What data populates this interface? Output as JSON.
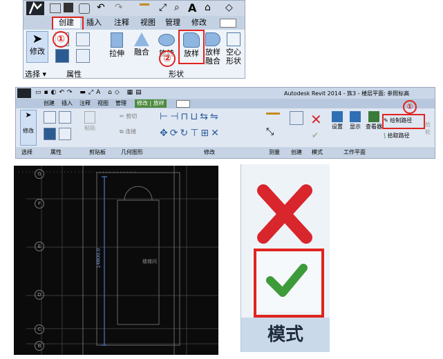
{
  "ribbon_top": {
    "tabs": [
      "创建",
      "插入",
      "注释",
      "视图",
      "管理",
      "修改"
    ],
    "buttons": {
      "modify": "修改",
      "extrude": "拉伸",
      "blend": "融合",
      "revolve": "旋转",
      "sweep": "放样",
      "swept_blend": "放样\n融合",
      "void": "空心\n形状"
    },
    "groups": {
      "select": "选择",
      "properties": "属性",
      "forms": "形状"
    },
    "markers": [
      "①",
      "②"
    ]
  },
  "ribbon_second": {
    "app_title": "Autodesk Revit 2014 -   族3 - 楼层平面: 参照标高",
    "tabs": [
      "创建",
      "插入",
      "注释",
      "视图",
      "管理",
      "修改 | 放样"
    ],
    "buttons": {
      "modify": "修改",
      "paste": "粘贴",
      "cut": "剪切",
      "join": "连接",
      "settings": "设置",
      "show": "显示",
      "viewer": "查看器",
      "draw_path": "绘制路径",
      "pick_path": "拾取路径",
      "more": "拾\n轮"
    },
    "groups": [
      "选择",
      "属性",
      "剪贴板",
      "几何图形",
      "修改",
      "测量",
      "创建",
      "模式",
      "工作平面"
    ],
    "marker": "①"
  },
  "cad_view": {
    "grid_labels": [
      "G",
      "F",
      "E",
      "D",
      "C",
      "B"
    ],
    "dimension_text": "14800.0",
    "room_label": "楼梯间"
  },
  "mode_panel": {
    "label": "模式"
  },
  "colors": {
    "accent_red": "#e0241e",
    "cancel_red": "#d8262c",
    "finish_green": "#3e9b3a",
    "ribbon_blue": "#dfe7f2"
  }
}
